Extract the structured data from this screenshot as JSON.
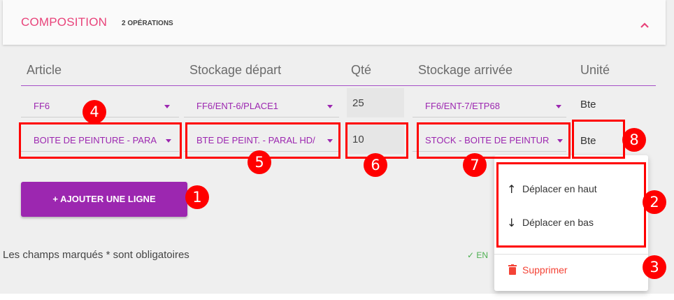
{
  "section": {
    "title": "COMPOSITION",
    "count": "2 OPÉRATIONS",
    "collapse_icon": "chevron-up-icon"
  },
  "columns": [
    "Article",
    "Stockage départ",
    "Qté",
    "Stockage arrivée",
    "Unité"
  ],
  "rows": [
    {
      "article": "FF6",
      "depart": "FF6/ENT-6/PLACE1",
      "qte": "25",
      "arrivee": "FF6/ENT-7/ETP68",
      "unite": "Bte"
    },
    {
      "article": "BOITE DE PEINTURE - PARA",
      "depart": "BTE DE PEINT. - PARAL HD/",
      "qte": "10",
      "arrivee": "STOCK - BOITE DE PEINTUR",
      "unite": "Bte"
    }
  ],
  "add_button": {
    "label": "+ AJOUTER UNE LIGNE"
  },
  "required_note": "Les champs marqués * sont obligatoires",
  "save_label_partial": "✓ EN",
  "context_menu": {
    "move_up": "Déplacer en haut",
    "move_up_icon": "arrow-up-icon",
    "move_down": "Déplacer en bas",
    "move_down_icon": "arrow-down-icon",
    "delete": "Supprimer",
    "delete_icon": "trash-icon"
  },
  "annotations": [
    "1",
    "2",
    "3",
    "4",
    "5",
    "6",
    "7",
    "8"
  ],
  "colors": {
    "accent": "#9c27b0",
    "title": "#e8437a",
    "annotation": "#ff0000",
    "delete": "#f44336"
  }
}
